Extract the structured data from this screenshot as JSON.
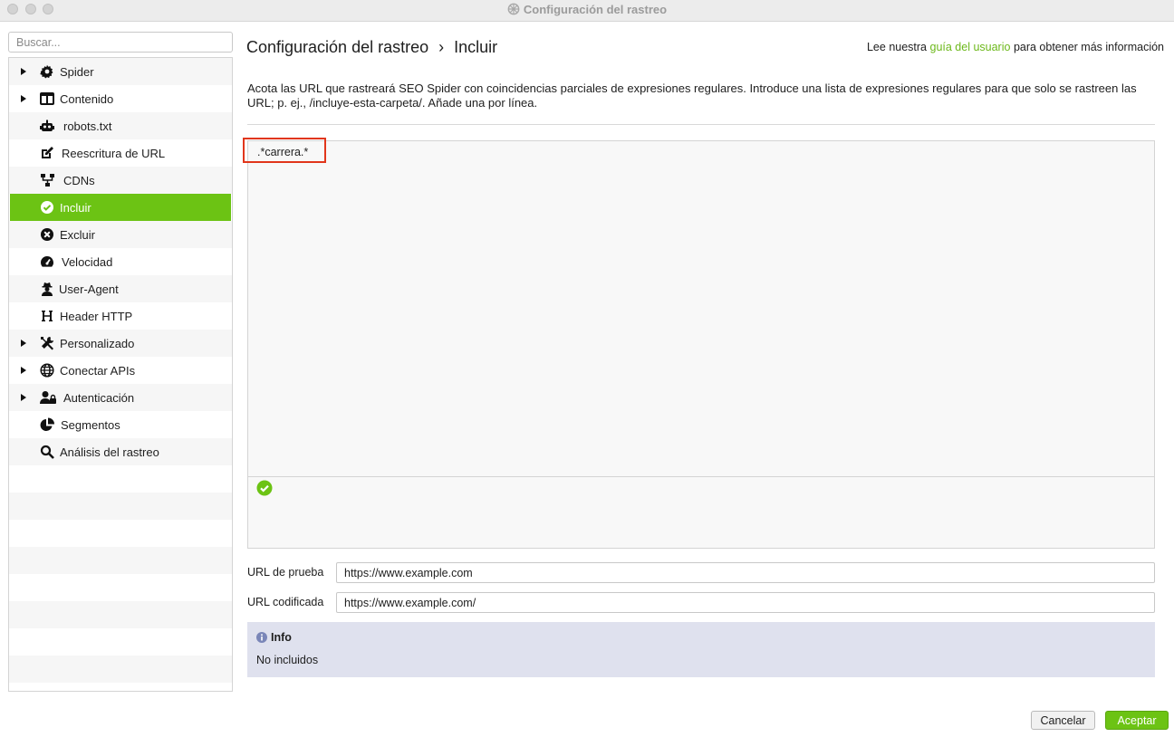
{
  "window": {
    "title": "Configuración del rastreo"
  },
  "search": {
    "placeholder": "Buscar..."
  },
  "sidebar": {
    "items": [
      {
        "label": "Spider",
        "icon": "gear-icon",
        "expandable": true,
        "active": false
      },
      {
        "label": "Contenido",
        "icon": "content-icon",
        "expandable": true,
        "active": false
      },
      {
        "label": "robots.txt",
        "icon": "robot-icon",
        "expandable": false,
        "active": false
      },
      {
        "label": "Reescritura de URL",
        "icon": "edit-icon",
        "expandable": false,
        "active": false
      },
      {
        "label": "CDNs",
        "icon": "network-icon",
        "expandable": false,
        "active": false
      },
      {
        "label": "Incluir",
        "icon": "check-circle-icon",
        "expandable": false,
        "active": true
      },
      {
        "label": "Excluir",
        "icon": "x-circle-icon",
        "expandable": false,
        "active": false
      },
      {
        "label": "Velocidad",
        "icon": "speedometer-icon",
        "expandable": false,
        "active": false
      },
      {
        "label": "User-Agent",
        "icon": "user-secret-icon",
        "expandable": false,
        "active": false
      },
      {
        "label": "Header HTTP",
        "icon": "heading-icon",
        "expandable": false,
        "active": false
      },
      {
        "label": "Personalizado",
        "icon": "tools-icon",
        "expandable": true,
        "active": false
      },
      {
        "label": "Conectar APIs",
        "icon": "globe-icon",
        "expandable": true,
        "active": false
      },
      {
        "label": "Autenticación",
        "icon": "user-lock-icon",
        "expandable": true,
        "active": false
      },
      {
        "label": "Segmentos",
        "icon": "pie-chart-icon",
        "expandable": false,
        "active": false
      },
      {
        "label": "Análisis del rastreo",
        "icon": "search-icon",
        "expandable": false,
        "active": false
      }
    ]
  },
  "header": {
    "breadcrumb_root": "Configuración del rastreo",
    "breadcrumb_sep": "›",
    "breadcrumb_current": "Incluir",
    "help_prefix": "Lee nuestra",
    "help_link": "guía del usuario",
    "help_suffix": "para obtener más información"
  },
  "description": "Acota las URL que rastreará SEO Spider con coincidencias parciales de expresiones regulares. Introduce una lista de expresiones regulares para que solo se rastreen las URL; p. ej., /incluye-esta-carpeta/. Añade una por línea.",
  "editor": {
    "lines": [
      ".*carrera.*"
    ]
  },
  "form": {
    "test_url_label": "URL de prueba",
    "test_url_value": "https://www.example.com",
    "encoded_url_label": "URL codificada",
    "encoded_url_value": "https://www.example.com/"
  },
  "info": {
    "title": "Info",
    "body": "No incluidos"
  },
  "buttons": {
    "cancel": "Cancelar",
    "ok": "Aceptar"
  },
  "colors": {
    "accent": "#6cc314",
    "highlight_border": "#e1361b",
    "info_bg": "#dfe1ee",
    "link": "#6cb81a"
  }
}
